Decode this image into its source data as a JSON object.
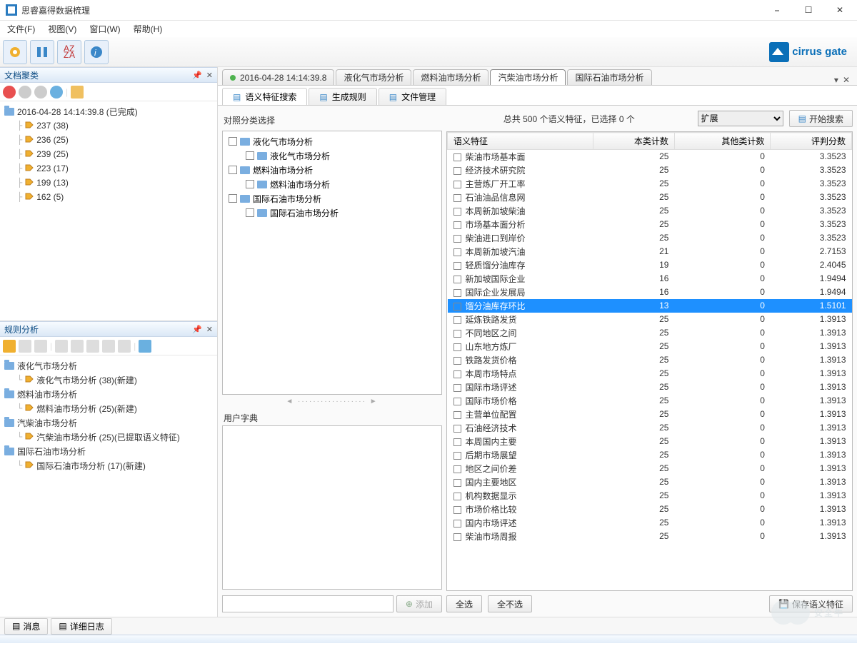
{
  "app": {
    "title": "思睿嘉得数据梳理",
    "brand": "cirrus gate"
  },
  "menus": [
    "文件(F)",
    "视图(V)",
    "窗口(W)",
    "帮助(H)"
  ],
  "left": {
    "docTitle": "文档聚类",
    "docRoot": "2016-04-28 14:14:39.8  (已完成)",
    "docItems": [
      "237  (38)",
      "236  (25)",
      "239  (25)",
      "223  (17)",
      "199  (13)",
      "162  (5)"
    ],
    "ruleTitle": "规则分析",
    "ruleTree": [
      {
        "folder": "液化气市场分析",
        "child": "液化气市场分析  (38)(新建)"
      },
      {
        "folder": "燃料油市场分析",
        "child": "燃料油市场分析  (25)(新建)"
      },
      {
        "folder": "汽柴油市场分析",
        "child": "汽柴油市场分析  (25)(已提取语义特征)"
      },
      {
        "folder": "国际石油市场分析",
        "child": "国际石油市场分析  (17)(新建)"
      }
    ]
  },
  "bottomTabs": [
    "消息",
    "详细日志"
  ],
  "docTabs": [
    {
      "label": "2016-04-28 14:14:39.8",
      "dot": true
    },
    {
      "label": "液化气市场分析"
    },
    {
      "label": "燃料油市场分析"
    },
    {
      "label": "汽柴油市场分析",
      "active": true
    },
    {
      "label": "国际石油市场分析"
    }
  ],
  "subTabs": [
    {
      "label": "语义特征搜索",
      "active": true
    },
    {
      "label": "生成规则"
    },
    {
      "label": "文件管理"
    }
  ],
  "catLabel": "对照分类选择",
  "catTree": [
    {
      "label": "液化气市场分析",
      "l": 1
    },
    {
      "label": "液化气市场分析",
      "l": 2
    },
    {
      "label": "燃料油市场分析",
      "l": 1
    },
    {
      "label": "燃料油市场分析",
      "l": 2
    },
    {
      "label": "国际石油市场分析",
      "l": 1
    },
    {
      "label": "国际石油市场分析",
      "l": 2
    }
  ],
  "userDictLabel": "用户字典",
  "addBtn": "添加",
  "feat": {
    "summary": "总共 500 个语义特征，已选择 0 个",
    "dropdown": "扩展",
    "searchBtn": "开始搜索",
    "cols": [
      "语义特征",
      "本类计数",
      "其他类计数",
      "评判分数"
    ],
    "rows": [
      {
        "n": "柴油市场基本面",
        "a": 25,
        "b": 0,
        "s": "3.3523"
      },
      {
        "n": "经济技术研究院",
        "a": 25,
        "b": 0,
        "s": "3.3523"
      },
      {
        "n": "主营炼厂开工率",
        "a": 25,
        "b": 0,
        "s": "3.3523"
      },
      {
        "n": "石油油品信息网",
        "a": 25,
        "b": 0,
        "s": "3.3523"
      },
      {
        "n": "本周新加坡柴油",
        "a": 25,
        "b": 0,
        "s": "3.3523"
      },
      {
        "n": "市场基本面分析",
        "a": 25,
        "b": 0,
        "s": "3.3523"
      },
      {
        "n": "柴油进口到岸价",
        "a": 25,
        "b": 0,
        "s": "3.3523"
      },
      {
        "n": "本周新加坡汽油",
        "a": 21,
        "b": 0,
        "s": "2.7153"
      },
      {
        "n": "轻质馏分油库存",
        "a": 19,
        "b": 0,
        "s": "2.4045"
      },
      {
        "n": "新加坡国际企业",
        "a": 16,
        "b": 0,
        "s": "1.9494"
      },
      {
        "n": "国际企业发展局",
        "a": 16,
        "b": 0,
        "s": "1.9494"
      },
      {
        "n": "馏分油库存环比",
        "a": 13,
        "b": 0,
        "s": "1.5101",
        "sel": true
      },
      {
        "n": "延炼铁路发货",
        "a": 25,
        "b": 0,
        "s": "1.3913"
      },
      {
        "n": "不同地区之间",
        "a": 25,
        "b": 0,
        "s": "1.3913"
      },
      {
        "n": "山东地方炼厂",
        "a": 25,
        "b": 0,
        "s": "1.3913"
      },
      {
        "n": "铁路发货价格",
        "a": 25,
        "b": 0,
        "s": "1.3913"
      },
      {
        "n": "本周市场特点",
        "a": 25,
        "b": 0,
        "s": "1.3913"
      },
      {
        "n": "国际市场评述",
        "a": 25,
        "b": 0,
        "s": "1.3913"
      },
      {
        "n": "国际市场价格",
        "a": 25,
        "b": 0,
        "s": "1.3913"
      },
      {
        "n": "主营单位配置",
        "a": 25,
        "b": 0,
        "s": "1.3913"
      },
      {
        "n": "石油经济技术",
        "a": 25,
        "b": 0,
        "s": "1.3913"
      },
      {
        "n": "本周国内主要",
        "a": 25,
        "b": 0,
        "s": "1.3913"
      },
      {
        "n": "后期市场展望",
        "a": 25,
        "b": 0,
        "s": "1.3913"
      },
      {
        "n": "地区之间价差",
        "a": 25,
        "b": 0,
        "s": "1.3913"
      },
      {
        "n": "国内主要地区",
        "a": 25,
        "b": 0,
        "s": "1.3913"
      },
      {
        "n": "机构数据显示",
        "a": 25,
        "b": 0,
        "s": "1.3913"
      },
      {
        "n": "市场价格比较",
        "a": 25,
        "b": 0,
        "s": "1.3913"
      },
      {
        "n": "国内市场评述",
        "a": 25,
        "b": 0,
        "s": "1.3913"
      },
      {
        "n": "柴油市场周报",
        "a": 25,
        "b": 0,
        "s": "1.3913"
      }
    ],
    "selectAll": "全选",
    "selectNone": "全不选",
    "save": "保存语义特征"
  },
  "watermark": "安全牛"
}
